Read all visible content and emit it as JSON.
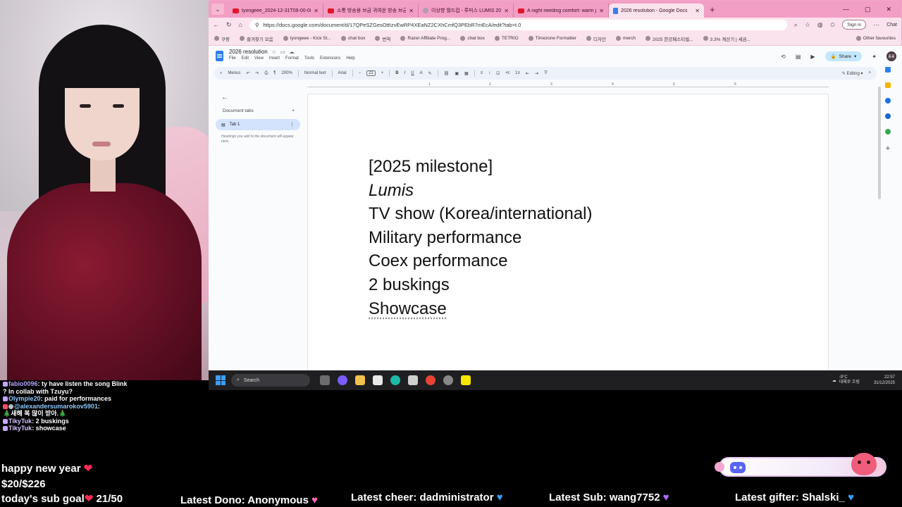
{
  "browser": {
    "tabs": [
      {
        "title": "tyongeee_2024-12-31T09-00-082...",
        "icon": "youtube-icon"
      },
      {
        "title": "소통 방송용 브금 귀여운 방송 브금",
        "icon": "youtube-icon"
      },
      {
        "title": "이상향 월드컵 - 루미스 LUMIS 2025",
        "icon": "page-icon"
      },
      {
        "title": "A night needing comfort: warm jaz",
        "icon": "youtube-icon"
      },
      {
        "title": "2026 resolution - Google Docs",
        "icon": "docs-icon",
        "active": true
      }
    ],
    "url": "https://docs.google.com/document/d/17QPeSZGesOttIzvEwRP4XEaNZ2CXhCmfQ3PEbR7mEcA/edit?tab=t.0",
    "signin_label": "Sign in",
    "chat_label": "Chat",
    "bookmarks": [
      "쿠팡",
      "즐겨찾기 모음",
      "tyongeee - Kick St...",
      "chat box",
      "번역",
      "Razer Affiliate Prog...",
      "chat box",
      "TETRIO",
      "Timezone Formatter",
      "디자인",
      "merch",
      "2025 한강페스티벌...",
      "3.3% 계산기 | 세금..."
    ],
    "other_favourites": "Other favourites"
  },
  "docs": {
    "title": "2026 resolution",
    "menus": [
      "File",
      "Edit",
      "View",
      "Insert",
      "Format",
      "Tools",
      "Extensions",
      "Help"
    ],
    "share_label": "Share",
    "avatar_initials": "종종",
    "toolbar": {
      "menus_label": "Menus",
      "zoom": "200%",
      "style": "Normal text",
      "font": "Arial",
      "font_size": "21",
      "mode": "Editing"
    },
    "ruler_ticks": [
      "1",
      "2",
      "3",
      "4",
      "5",
      "6"
    ],
    "sidebar": {
      "header": "Document tabs",
      "tab_label": "Tab 1",
      "hint": "Headings you add to the document will appear here."
    },
    "body_lines": [
      "[2025 milestone]",
      "Lumis",
      "TV show (Korea/international)",
      "Military performance",
      "Coex performance",
      "2 buskings",
      "Showcase"
    ]
  },
  "taskbar": {
    "search_label": "Search",
    "weather_temp": "-9°C",
    "weather_desc": "대체로 흐림",
    "time": "22:57",
    "date": "31/12/2025"
  },
  "chat": [
    {
      "user": "fabio0096",
      "text": ": ty have listen the song Blink ? In collab with Tzuyu?"
    },
    {
      "user": "Olympie20",
      "text": ": paid for performances"
    },
    {
      "user": "@alexandersumarokov5901",
      "text": ":"
    },
    {
      "user": "",
      "text": "🎄새해 복 많이 받아.🎄"
    },
    {
      "user": "TikyTuk",
      "text": ": 2 buskings"
    },
    {
      "user": "TikyTuk",
      "text": ": showcase"
    }
  ],
  "overlay": {
    "greeting": "happy new year",
    "dono_goal": "$20/$226",
    "sub_goal_label": "today's sub goal",
    "sub_goal_value": "21/50",
    "latest_dono": "Latest Dono: Anonymous",
    "latest_cheer": "Latest cheer: dadministrator",
    "latest_sub": "Latest Sub: wang7752",
    "latest_gifter": "Latest gifter: Shalski_"
  }
}
